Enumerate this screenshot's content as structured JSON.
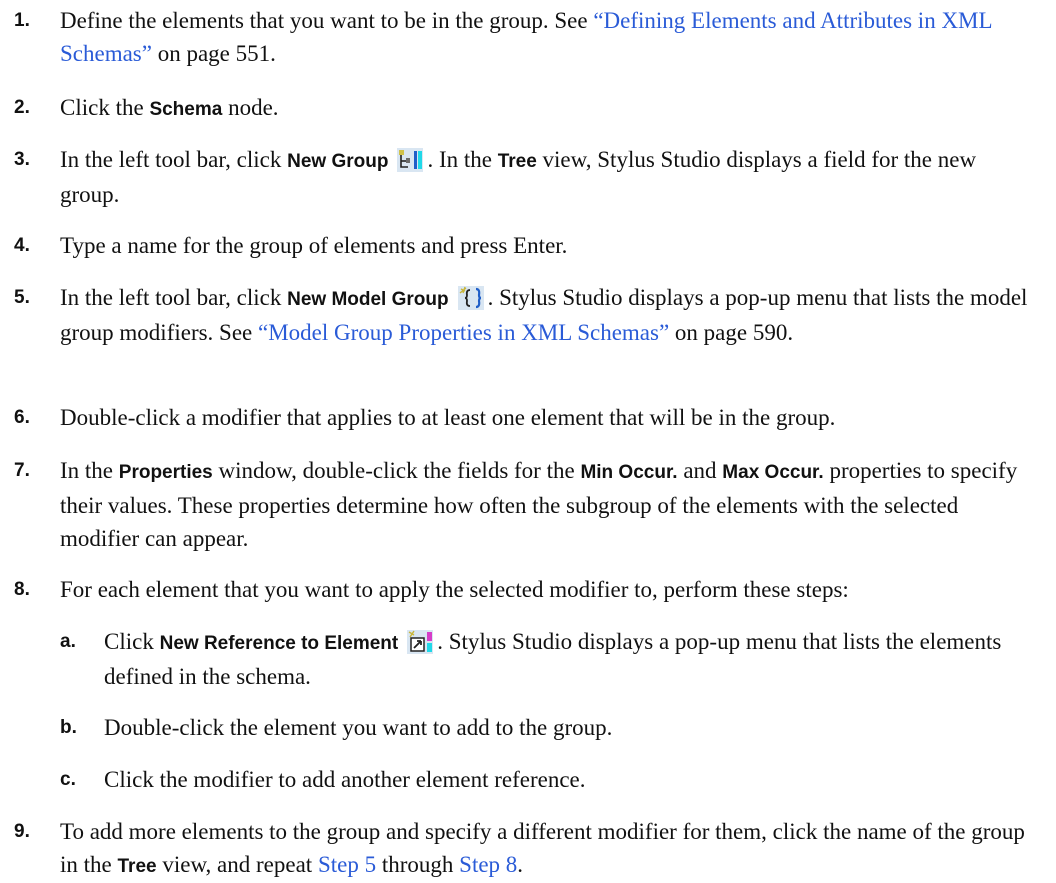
{
  "steps": [
    {
      "num": "1.",
      "t1": "Define the elements that you want to be in the group. See ",
      "link": "“Defining Elements and Attributes in XML Schemas”",
      "t2": " on page 551."
    },
    {
      "num": "2.",
      "t1": "Click the ",
      "ui1": "Schema",
      "t2": " node."
    },
    {
      "num": "3.",
      "t1": "In the left tool bar, click ",
      "ui1": "New Group",
      "icon": "new-group-icon",
      "t2": ". In the ",
      "ui2": "Tree",
      "t3": " view, Stylus Studio displays a field for the new group."
    },
    {
      "num": "4.",
      "t1": "Type a name for the group of elements and press Enter."
    },
    {
      "num": "5.",
      "t1": "In the left tool bar, click ",
      "ui1": "New Model Group",
      "icon": "new-model-group-icon",
      "t2": ". Stylus Studio displays a pop-up menu that lists the model group modifiers. See ",
      "link": "“Model Group Properties in XML Schemas”",
      "t3": " on page 590."
    },
    {
      "num": "6.",
      "t1": "Double-click a modifier that applies to at least one element that will be in the group."
    },
    {
      "num": "7.",
      "t1": "In the ",
      "ui1": "Properties",
      "t2": " window, double-click the fields for the ",
      "ui2": "Min Occur.",
      "t3": " and ",
      "ui3": "Max Occur.",
      "t4": " properties to specify their values. These properties determine how often the subgroup of the elements with the selected modifier can appear."
    },
    {
      "num": "8.",
      "t1": "For each element that you want to apply the selected modifier to, perform these steps:",
      "substeps": [
        {
          "num": "a.",
          "t1": "Click ",
          "ui1": "New Reference to Element",
          "icon": "new-reference-to-element-icon",
          "t2": ". Stylus Studio displays a pop-up menu that lists the elements defined in the schema."
        },
        {
          "num": "b.",
          "t1": "Double-click the element you want to add to the group."
        },
        {
          "num": "c.",
          "t1": "Click the modifier to add another element reference."
        }
      ]
    },
    {
      "num": "9.",
      "t1": "To add more elements to the group and specify a different modifier for them, click the name of the group in the ",
      "ui1": "Tree",
      "t2": " view, and repeat ",
      "link1": "Step 5",
      "t3": " through ",
      "link2": "Step 8",
      "t4": "."
    }
  ],
  "colors": {
    "link": "#2a5bd7",
    "text": "#111111",
    "background": "#ffffff"
  }
}
